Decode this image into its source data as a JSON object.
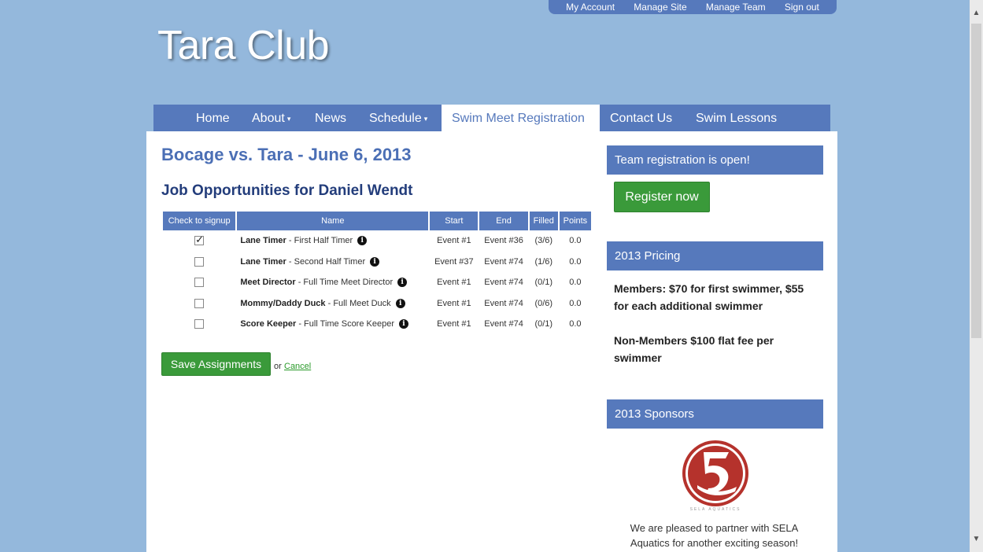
{
  "topbar": [
    "My Account",
    "Manage Site",
    "Manage Team",
    "Sign out"
  ],
  "site_title": "Tara Club",
  "nav": [
    {
      "label": "Home",
      "dropdown": false
    },
    {
      "label": "About",
      "dropdown": true
    },
    {
      "label": "News",
      "dropdown": false
    },
    {
      "label": "Schedule",
      "dropdown": true
    },
    {
      "label": "Swim Meet Registration",
      "dropdown": false,
      "active": true
    },
    {
      "label": "Contact Us",
      "dropdown": false
    },
    {
      "label": "Swim Lessons",
      "dropdown": false
    }
  ],
  "main": {
    "meet_title": "Bocage vs. Tara - June 6, 2013",
    "job_title": "Job Opportunities for Daniel Wendt",
    "table": {
      "headers": [
        "Check to signup",
        "Name",
        "Start",
        "End",
        "Filled",
        "Points"
      ],
      "rows": [
        {
          "checked": true,
          "name": "Lane Timer",
          "desc": " - First Half Timer",
          "start": "Event #1",
          "end": "Event #36",
          "filled": "(3/6)",
          "points": "0.0"
        },
        {
          "checked": false,
          "name": "Lane Timer",
          "desc": " - Second Half Timer",
          "start": "Event #37",
          "end": "Event #74",
          "filled": "(1/6)",
          "points": "0.0"
        },
        {
          "checked": false,
          "name": "Meet Director",
          "desc": " - Full Time Meet Director",
          "start": "Event #1",
          "end": "Event #74",
          "filled": "(0/1)",
          "points": "0.0"
        },
        {
          "checked": false,
          "name": "Mommy/Daddy Duck",
          "desc": " - Full Meet Duck",
          "start": "Event #1",
          "end": "Event #74",
          "filled": "(0/6)",
          "points": "0.0"
        },
        {
          "checked": false,
          "name": "Score Keeper",
          "desc": " - Full Time Score Keeper",
          "start": "Event #1",
          "end": "Event #74",
          "filled": "(0/1)",
          "points": "0.0"
        }
      ]
    },
    "save_label": "Save Assignments",
    "or_text": "or",
    "cancel_label": "Cancel"
  },
  "sidebar": {
    "reg_header": "Team registration is open!",
    "register_label": "Register now",
    "pricing_header": "2013 Pricing",
    "pricing_members": "Members: $70 for first swimmer, $55 for each additional swimmer",
    "pricing_nonmembers": "Non-Members $100 flat fee per swimmer",
    "sponsors_header": "2013 Sponsors",
    "sponsor_logo_text": "SELA AQUATICS",
    "sponsor_text": "We are pleased to partner with SELA Aquatics for another exciting season!"
  },
  "colors": {
    "brand_blue": "#5679bc",
    "green": "#3a9a3a",
    "background": "#94b8dc"
  }
}
